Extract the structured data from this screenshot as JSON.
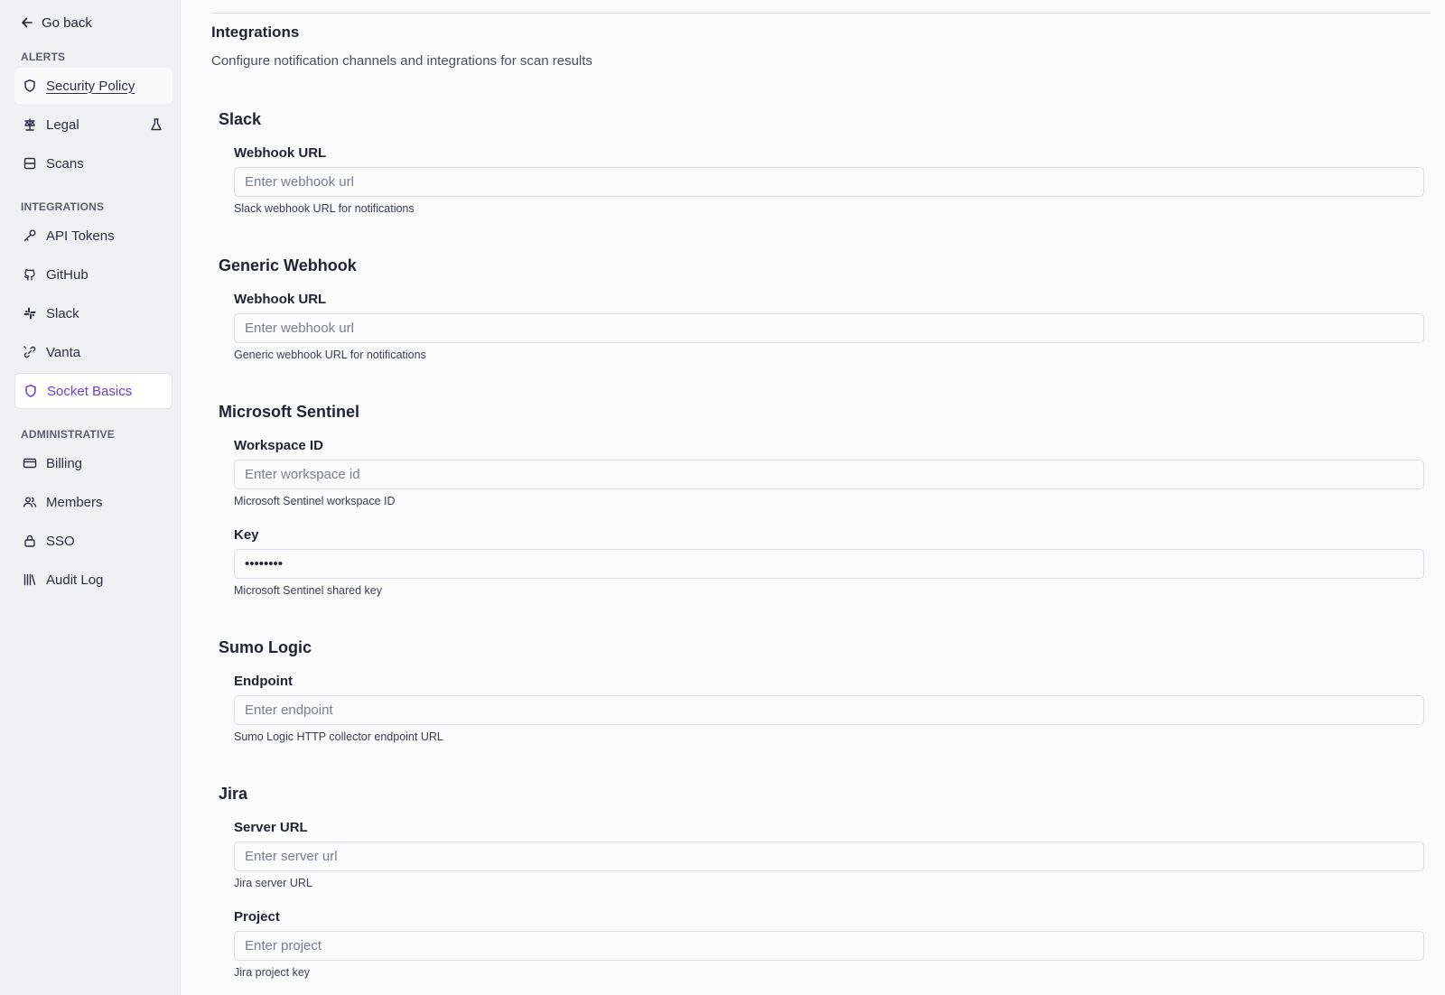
{
  "sidebar": {
    "go_back": "Go back",
    "sections": [
      {
        "title": "ALERTS"
      },
      {
        "title": "INTEGRATIONS"
      },
      {
        "title": "ADMINISTRATIVE"
      }
    ],
    "items": [
      {
        "label": "Security Policy",
        "icon": "shield-icon"
      },
      {
        "label": "Legal",
        "icon": "scale-icon",
        "badge": "flask-icon"
      },
      {
        "label": "Scans",
        "icon": "scan-icon"
      },
      {
        "label": "API Tokens",
        "icon": "key-icon"
      },
      {
        "label": "GitHub",
        "icon": "github-icon"
      },
      {
        "label": "Slack",
        "icon": "slack-icon"
      },
      {
        "label": "Vanta",
        "icon": "link-icon"
      },
      {
        "label": "Socket Basics",
        "icon": "shield-icon"
      },
      {
        "label": "Billing",
        "icon": "credit-card-icon"
      },
      {
        "label": "Members",
        "icon": "users-icon"
      },
      {
        "label": "SSO",
        "icon": "lock-icon"
      },
      {
        "label": "Audit Log",
        "icon": "library-icon"
      }
    ],
    "accent_color": "#6b3fd1"
  },
  "main": {
    "title": "Integrations",
    "description": "Configure notification channels and integrations for scan results",
    "groups": [
      {
        "title": "Slack",
        "fields": [
          {
            "label": "Webhook URL",
            "placeholder": "Enter webhook url",
            "value": "",
            "help": "Slack webhook URL for notifications"
          }
        ]
      },
      {
        "title": "Generic Webhook",
        "fields": [
          {
            "label": "Webhook URL",
            "placeholder": "Enter webhook url",
            "value": "",
            "help": "Generic webhook URL for notifications"
          }
        ]
      },
      {
        "title": "Microsoft Sentinel",
        "fields": [
          {
            "label": "Workspace ID",
            "placeholder": "Enter workspace id",
            "value": "",
            "help": "Microsoft Sentinel workspace ID"
          },
          {
            "label": "Key",
            "placeholder": "",
            "value": "••••••••",
            "help": "Microsoft Sentinel shared key"
          }
        ]
      },
      {
        "title": "Sumo Logic",
        "fields": [
          {
            "label": "Endpoint",
            "placeholder": "Enter endpoint",
            "value": "",
            "help": "Sumo Logic HTTP collector endpoint URL"
          }
        ]
      },
      {
        "title": "Jira",
        "fields": [
          {
            "label": "Server URL",
            "placeholder": "Enter server url",
            "value": "",
            "help": "Jira server URL"
          },
          {
            "label": "Project",
            "placeholder": "Enter project",
            "value": "",
            "help": "Jira project key"
          }
        ]
      }
    ]
  }
}
